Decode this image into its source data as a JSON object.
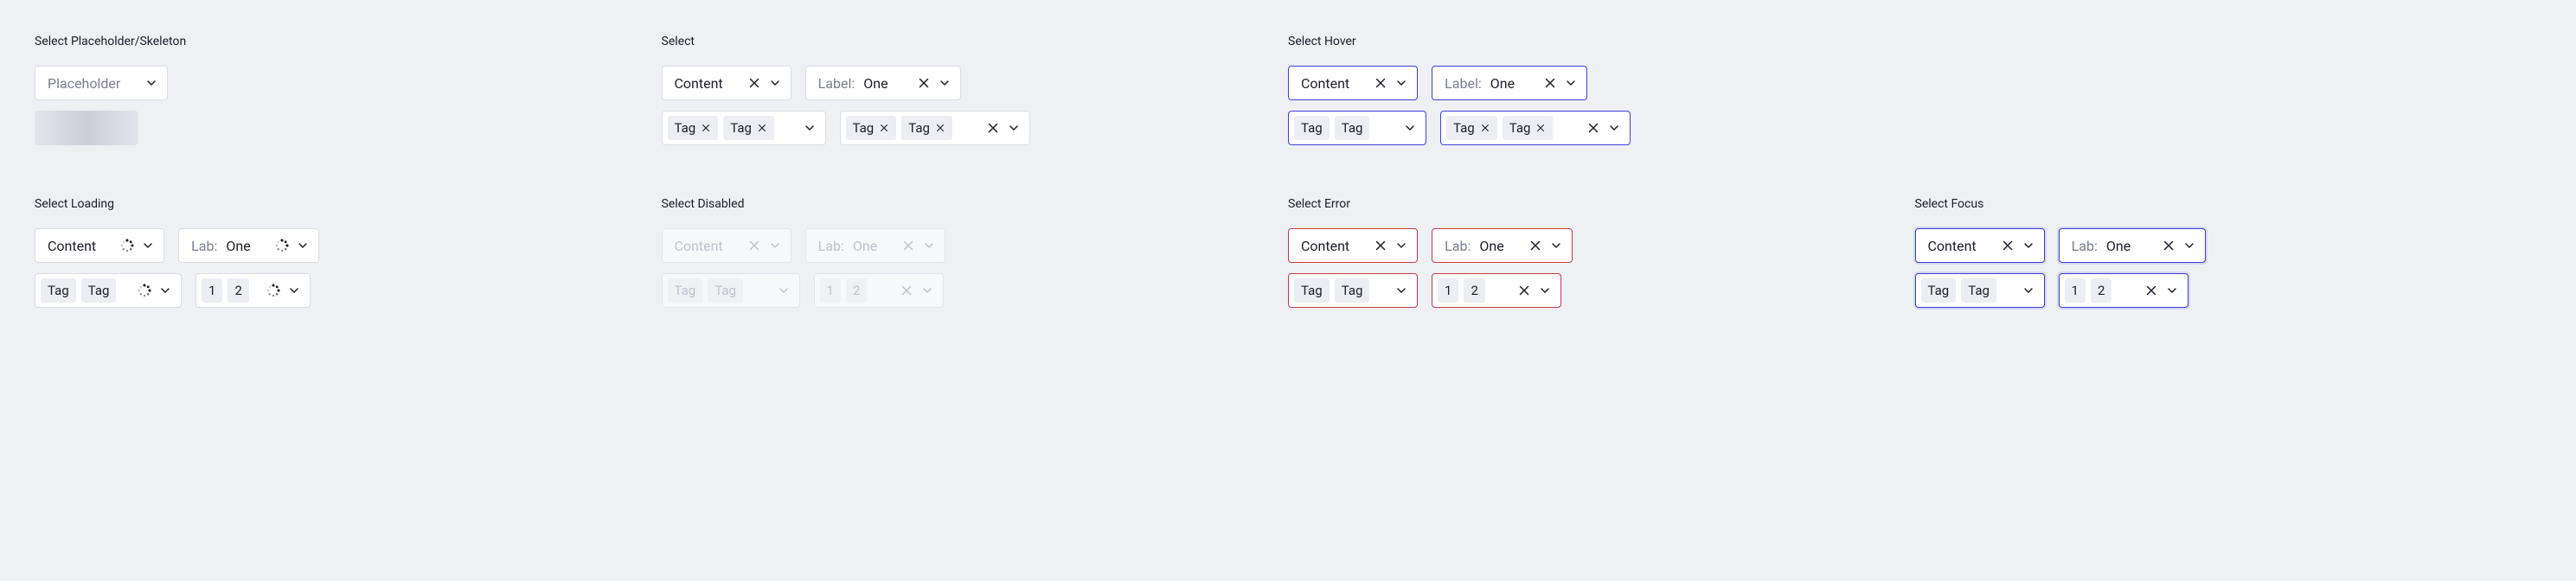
{
  "sections": {
    "placeholder": {
      "title": "Select Placeholder/Skeleton",
      "placeholder": "Placeholder"
    },
    "normal": {
      "title": "Select"
    },
    "hover": {
      "title": "Select Hover"
    },
    "loading": {
      "title": "Select Loading"
    },
    "disabled": {
      "title": "Select Disabled"
    },
    "error": {
      "title": "Select Error"
    },
    "focus": {
      "title": "Select Focus"
    }
  },
  "common": {
    "content": "Content",
    "label_full": "Label:",
    "label_short": "Lab:",
    "value_one": "One",
    "tag": "Tag",
    "num1": "1",
    "num2": "2"
  },
  "colors": {
    "border": "#DCDDE4",
    "primary": "#3A41E0",
    "error": "#C73A3A",
    "muted": "#7B7D91"
  }
}
